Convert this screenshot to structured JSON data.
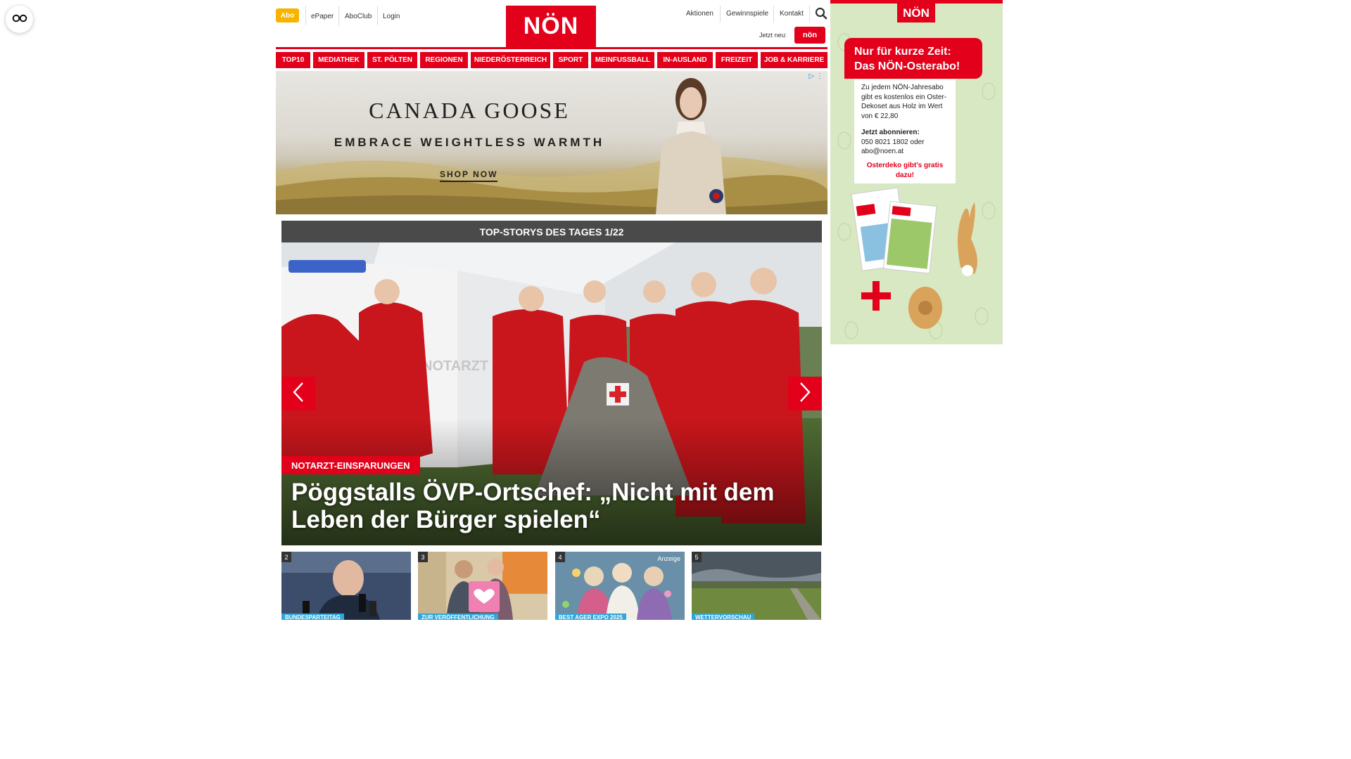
{
  "accessibility": {
    "icon": "glasses-icon"
  },
  "header": {
    "abo_label": "Abo",
    "links_left": [
      "ePaper",
      "AboClub",
      "Login"
    ],
    "logo_text": "NÖN",
    "links_right": [
      "Aktionen",
      "Gewinnspiele",
      "Kontakt"
    ],
    "search_icon": "search-icon",
    "jetzt_neu_label": "Jetzt neu:",
    "jetzt_neu_logo": "nön"
  },
  "nav": {
    "items": [
      "TOP10",
      "MEDIATHEK",
      "ST. PÖLTEN",
      "REGIONEN",
      "NIEDERÖSTERREICH",
      "SPORT",
      "MEINFUSSBALL",
      "IN-AUSLAND",
      "FREIZEIT",
      "JOB & KARRIERE"
    ]
  },
  "ad_banner": {
    "brand": "CANADA GOOSE",
    "tagline": "EMBRACE WEIGHTLESS WARMTH",
    "cta": "SHOP NOW"
  },
  "top_stories": {
    "header": "TOP-STORYS DES TAGES 1/22",
    "hero": {
      "kicker": "NOTARZT-EINSPARUNGEN",
      "title": "Pöggstalls ÖVP-Ortschef: „Nicht mit dem Leben der Bürger spielen“",
      "vehicle_label": "NOTARZT"
    },
    "thumbnails": [
      {
        "num": "2",
        "tag": "BUNDESPARTEITAG",
        "anzeige": ""
      },
      {
        "num": "3",
        "tag": "ZUR VERÖFFENTLICHUNG",
        "anzeige": ""
      },
      {
        "num": "4",
        "tag": "BEST AGER EXPO 2025",
        "anzeige": "Anzeige"
      },
      {
        "num": "5",
        "tag": "WETTERVORSCHAU",
        "anzeige": ""
      }
    ]
  },
  "side_ad": {
    "logo": "NÖN",
    "headline_line1": "Nur für kurze Zeit:",
    "headline_line2": "Das NÖN-Osterabo!",
    "body": "Zu jedem NÖN-Jahresabo gibt es kostenlos ein Oster-Dekoset aus Holz im Wert von € 22,80",
    "cta_title": "Jetzt abonnieren:",
    "cta_phone": "050 8021 1802 oder",
    "cta_email": "abo@noen.at",
    "promo": "Osterdeko gibt’s gratis dazu!"
  },
  "colors": {
    "brand_red": "#e2001a",
    "abo_yellow": "#f5b400",
    "tag_blue": "#2fa7d8"
  }
}
